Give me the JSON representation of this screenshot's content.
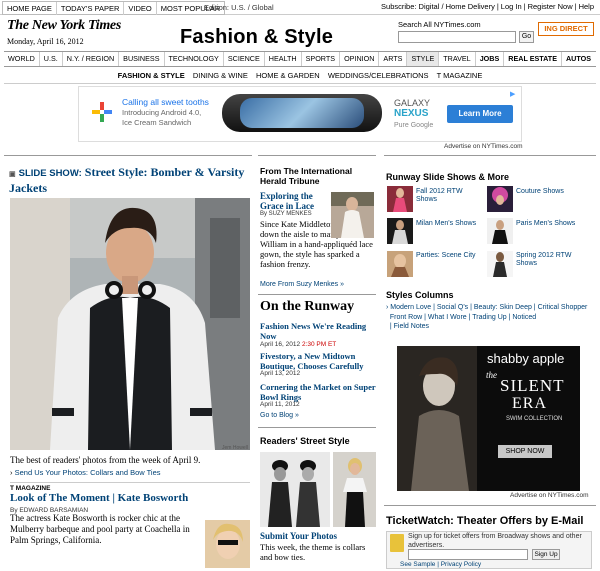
{
  "topbar": {
    "links": [
      "HOME PAGE",
      "TODAY'S PAPER",
      "VIDEO",
      "MOST POPULAR"
    ],
    "edition": "Edition: U.S. / Global",
    "right": [
      "Subscribe: Digital / Home Delivery",
      "Log In",
      "Register Now",
      "Help"
    ]
  },
  "masthead": {
    "logo": "The New York Times",
    "date": "Monday, April 16, 2012",
    "section_title": "Fashion & Style",
    "search_label": "Search All NYTimes.com",
    "search_placeholder": "",
    "go": "Go",
    "sponsor": "ING DIRECT"
  },
  "nav": [
    "WORLD",
    "U.S.",
    "N.Y. / REGION",
    "BUSINESS",
    "TECHNOLOGY",
    "SCIENCE",
    "HEALTH",
    "SPORTS",
    "OPINION",
    "ARTS",
    "STYLE",
    "TRAVEL",
    "JOBS",
    "REAL ESTATE",
    "AUTOS"
  ],
  "subnav": [
    "FASHION & STYLE",
    "DINING & WINE",
    "HOME & GARDEN",
    "WEDDINGS/CELEBRATIONS",
    "T MAGAZINE"
  ],
  "ad_banner": {
    "line1": "Calling all sweet tooths",
    "line2": "Introducing Android 4.0,",
    "line3": "Ice Cream Sandwich",
    "brand1": "GALAXY",
    "brand2": "NEXUS",
    "brand3": "Pure Google",
    "cta": "Learn More",
    "note": "Advertise on NYTimes.com"
  },
  "col1": {
    "slideshow_label": "SLIDE SHOW:",
    "headline": "Street Style: Bomber & Varsity Jackets",
    "photo_credit": "Jem Howell",
    "caption": "The best of readers' photos from the week of April 9.",
    "send_link": "Send Us Your Photos: Collars and Bow Ties",
    "tmag_label": "T MAGAZINE",
    "look_headline": "Look of The Moment | Kate Bosworth",
    "look_byline": "By EDWARD BARSAMIAN",
    "look_summary": "The actress Kate Bosworth is rocker chic at the Mulberry barbeque and pool party at Coachella in Palm Springs, California."
  },
  "col2": {
    "iht_head": "From The International Herald Tribune",
    "iht_title": "Exploring the Grace in Lace",
    "iht_byline": "By SUZY MENKES",
    "iht_summary": "Since Kate Middleton walked down the aisle to marry Prince William in a hand-appliquéd lace gown, the style has sparked a fashion frenzy.",
    "iht_more": "More From Suzy Menkes »",
    "runway_head": "On the Runway",
    "runway_items": [
      {
        "title": "Fashion News We're Reading Now",
        "date": "April 16, 2012",
        "time": "2:30 PM ET"
      },
      {
        "title": "Fivestory, a New Midtown Boutique, Chooses Carefully",
        "date": "April 13, 2012",
        "time": ""
      },
      {
        "title": "Cornering the Market on Super Bowl Rings",
        "date": "April 11, 2012",
        "time": ""
      }
    ],
    "go_blog": "Go to Blog »",
    "street_head": "Readers' Street Style",
    "submit_head": "Submit Your Photos",
    "submit_summary": "This week, the theme is collars and bow ties."
  },
  "col3": {
    "runway_shows_head": "Runway Slide Shows & More",
    "shows": [
      "Fall 2012 RTW Shows",
      "Couture Shows",
      "Milan Men's Shows",
      "Paris Men's Shows",
      "Parties: Scene City",
      "Spring 2012 RTW Shows"
    ],
    "styles_head": "Styles Columns",
    "styles_links": [
      "Modern Love",
      "Social Q's",
      "Beauty: Skin Deep",
      "Critical Shopper",
      "Front Row",
      "What I Wore",
      "Trading Up",
      "Noticed",
      "Field Notes"
    ],
    "ad_brand": "shabby apple",
    "ad_the": "the",
    "ad_silent": "SILENT",
    "ad_era": "ERA",
    "ad_collection": "SWIM COLLECTION",
    "ad_cta": "SHOP NOW",
    "ad_note": "Advertise on NYTimes.com",
    "tix_head": "TicketWatch: Theater Offers by E-Mail",
    "tix_text": "Sign up for ticket offers from Broadway shows and other advertisers.",
    "tix_btn": "Sign Up",
    "tix_links": "See Sample | Privacy Policy"
  }
}
